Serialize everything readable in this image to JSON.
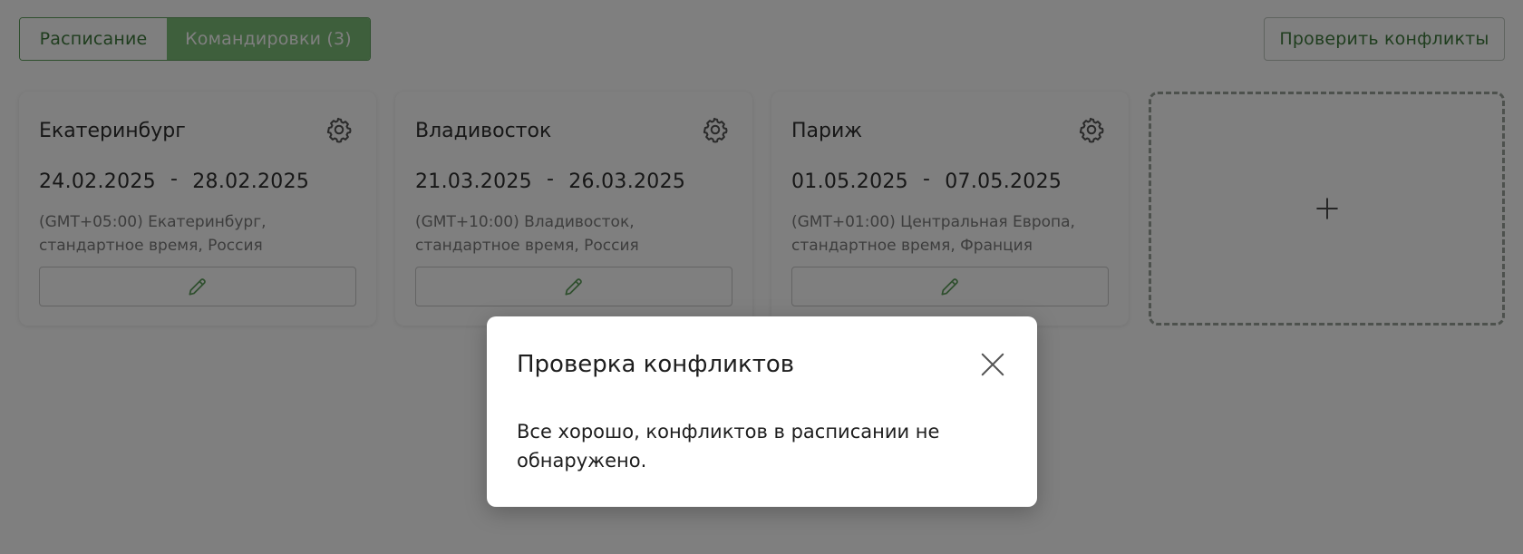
{
  "tabs": {
    "schedule_label": "Расписание",
    "trips_label": "Командировки (3)"
  },
  "header": {
    "check_conflicts_label": "Проверить конфликты"
  },
  "trips": [
    {
      "city": "Екатеринбург",
      "date_from": "24.02.2025",
      "date_sep": "-",
      "date_to": "28.02.2025",
      "timezone": "(GMT+05:00) Екатеринбург, стандартное время, Россия"
    },
    {
      "city": "Владивосток",
      "date_from": "21.03.2025",
      "date_sep": "-",
      "date_to": "26.03.2025",
      "timezone": "(GMT+10:00) Владивосток, стандартное время, Россия"
    },
    {
      "city": "Париж",
      "date_from": "01.05.2025",
      "date_sep": "-",
      "date_to": "07.05.2025",
      "timezone": "(GMT+01:00) Центральная Европа, стандартное время, Франция"
    }
  ],
  "add_card": {
    "icon": "plus-icon"
  },
  "modal": {
    "title": "Проверка конфликтов",
    "message": "Все хорошо, конфликтов в расписании не обнаружено."
  },
  "colors": {
    "accent": "#7dbf78",
    "accent_text": "#3e7a3c",
    "overlay": "rgba(0,0,0,0.5)"
  }
}
